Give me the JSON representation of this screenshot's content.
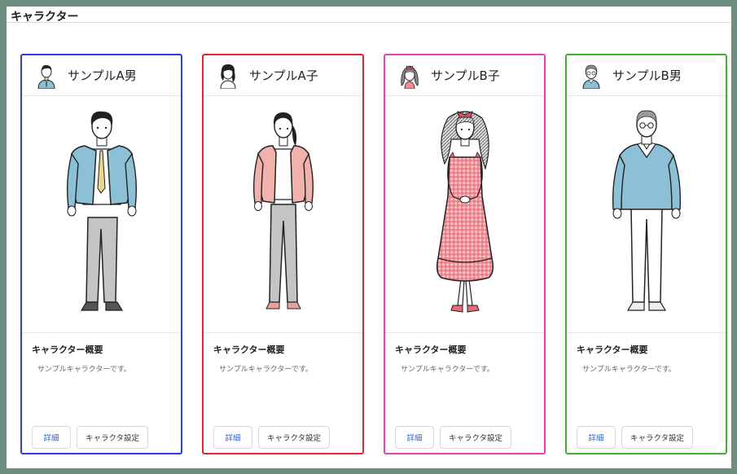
{
  "page": {
    "title": "キャラクター"
  },
  "cards": [
    {
      "name": "サンプルA男",
      "border_color": "#2a3fe0",
      "summary_title": "キャラクター概要",
      "summary_text": "サンプルキャラクターです。",
      "detail_label": "詳細",
      "settings_label": "キャラクタ設定",
      "avatar_icon": "young-man-avatar-icon"
    },
    {
      "name": "サンプルA子",
      "border_color": "#e0282e",
      "summary_title": "キャラクター概要",
      "summary_text": "サンプルキャラクターです。",
      "detail_label": "詳細",
      "settings_label": "キャラクタ設定",
      "avatar_icon": "young-woman-avatar-icon"
    },
    {
      "name": "サンプルB子",
      "border_color": "#e23fc4",
      "summary_title": "キャラクター概要",
      "summary_text": "サンプルキャラクターです。",
      "detail_label": "詳細",
      "settings_label": "キャラクタ設定",
      "avatar_icon": "girl-avatar-icon"
    },
    {
      "name": "サンプルB男",
      "border_color": "#3fb52c",
      "summary_title": "キャラクター概要",
      "summary_text": "サンプルキャラクターです。",
      "detail_label": "詳細",
      "settings_label": "キャラクタ設定",
      "avatar_icon": "older-man-avatar-icon"
    }
  ]
}
